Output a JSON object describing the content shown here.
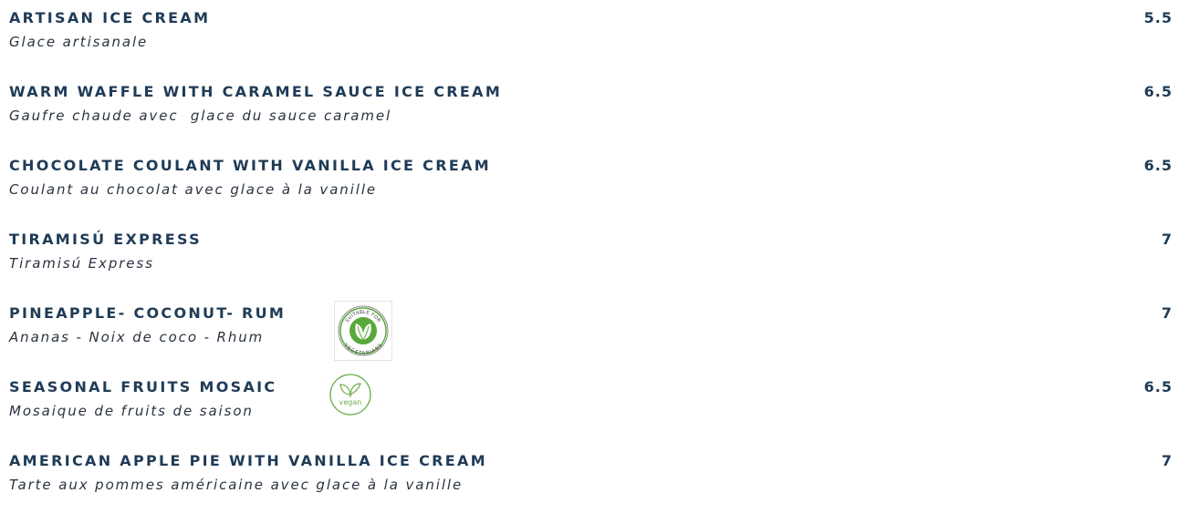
{
  "menu": {
    "items": [
      {
        "name": "ARTISAN ICE CREAM",
        "description": "Glace artisanale",
        "price": "5.5"
      },
      {
        "name": "WARM WAFFLE WITH CARAMEL SAUCE ICE CREAM",
        "description": "Gaufre chaude avec  glace du sauce caramel",
        "price": "6.5"
      },
      {
        "name": "CHOCOLATE COULANT WITH VANILLA ICE CREAM",
        "description": "Coulant au chocolat avec glace à la vanille",
        "price": "6.5"
      },
      {
        "name": "TIRAMISÚ EXPRESS",
        "description": "Tiramisú Express",
        "price": "7"
      },
      {
        "name": "PINEAPPLE- COCONUT- RUM",
        "description": "Ananas - Noix de coco - Rhum",
        "price": "7",
        "badge": {
          "icon": "suitable-for-vegetarians-icon",
          "text_top": "SUITABLE FOR",
          "text_bottom": "VEGETARIANS",
          "color": "#5aa83a"
        }
      },
      {
        "name": "SEASONAL FRUITS MOSAIC",
        "description": "Mosaique de fruits de saison",
        "price": "6.5",
        "badge": {
          "icon": "vegan-icon",
          "text": "vegan",
          "color": "#6fae4f"
        }
      },
      {
        "name": "AMERICAN APPLE PIE WITH VANILLA ICE CREAM",
        "description": "Tarte aux pommes américaine avec glace à la vanille",
        "price": "7"
      }
    ]
  },
  "colors": {
    "heading": "#1f3b57",
    "description": "#2a3340"
  }
}
